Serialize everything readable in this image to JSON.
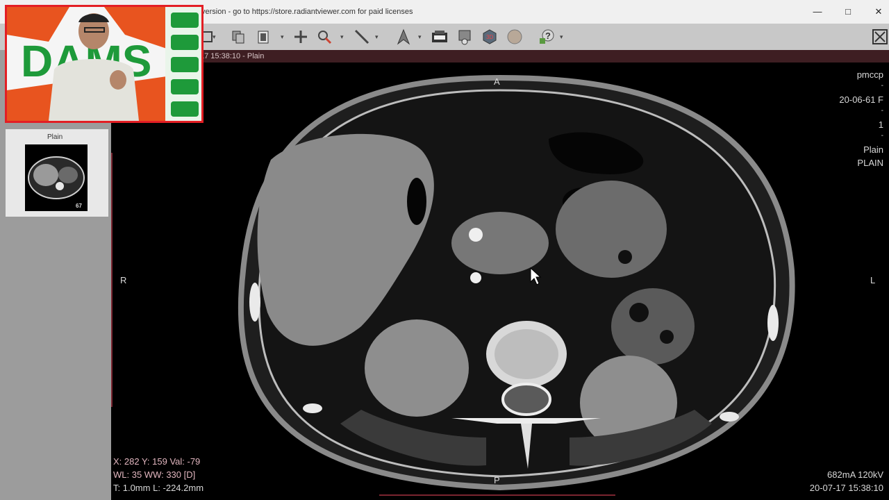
{
  "window": {
    "title": "version - go to https://store.radiantviewer.com for paid licenses",
    "controls": {
      "minimize": "—",
      "maximize": "□",
      "close": "✕"
    }
  },
  "toolbar": {
    "icons": [
      "layout-icon",
      "copy-icon",
      "series-icon",
      "crosshair-icon",
      "zoom-icon",
      "measure-icon",
      "adjust-icon",
      "export-icon",
      "mpr-icon",
      "3d-icon",
      "fusion-icon",
      "help-icon"
    ]
  },
  "infobar": {
    "text": "17 15:38:10 - Plain"
  },
  "sidebar": {
    "thumb_label": "Plain",
    "thumb_count": "67"
  },
  "viewer": {
    "orient_top": "A",
    "orient_bottom": "P",
    "orient_left": "R",
    "orient_right": "L",
    "top_right": [
      "pmccp",
      "-",
      "20-06-61 F",
      "-",
      "1",
      "-",
      "Plain",
      "PLAIN"
    ],
    "bottom_left": [
      "X: 282 Y: 159 Val: -79",
      "WL: 35 WW: 330 [D]",
      "T: 1.0mm L: -224.2mm"
    ],
    "bottom_right": [
      "682mA 120kV",
      "20-07-17 15:38:10"
    ]
  },
  "webcam": {
    "banner_text": "DAMS"
  },
  "colors": {
    "accent_border": "#e31e24",
    "infobar": "#3e1e22",
    "toolbar": "#c8c8c8",
    "sidebar": "#9c9c9c"
  }
}
